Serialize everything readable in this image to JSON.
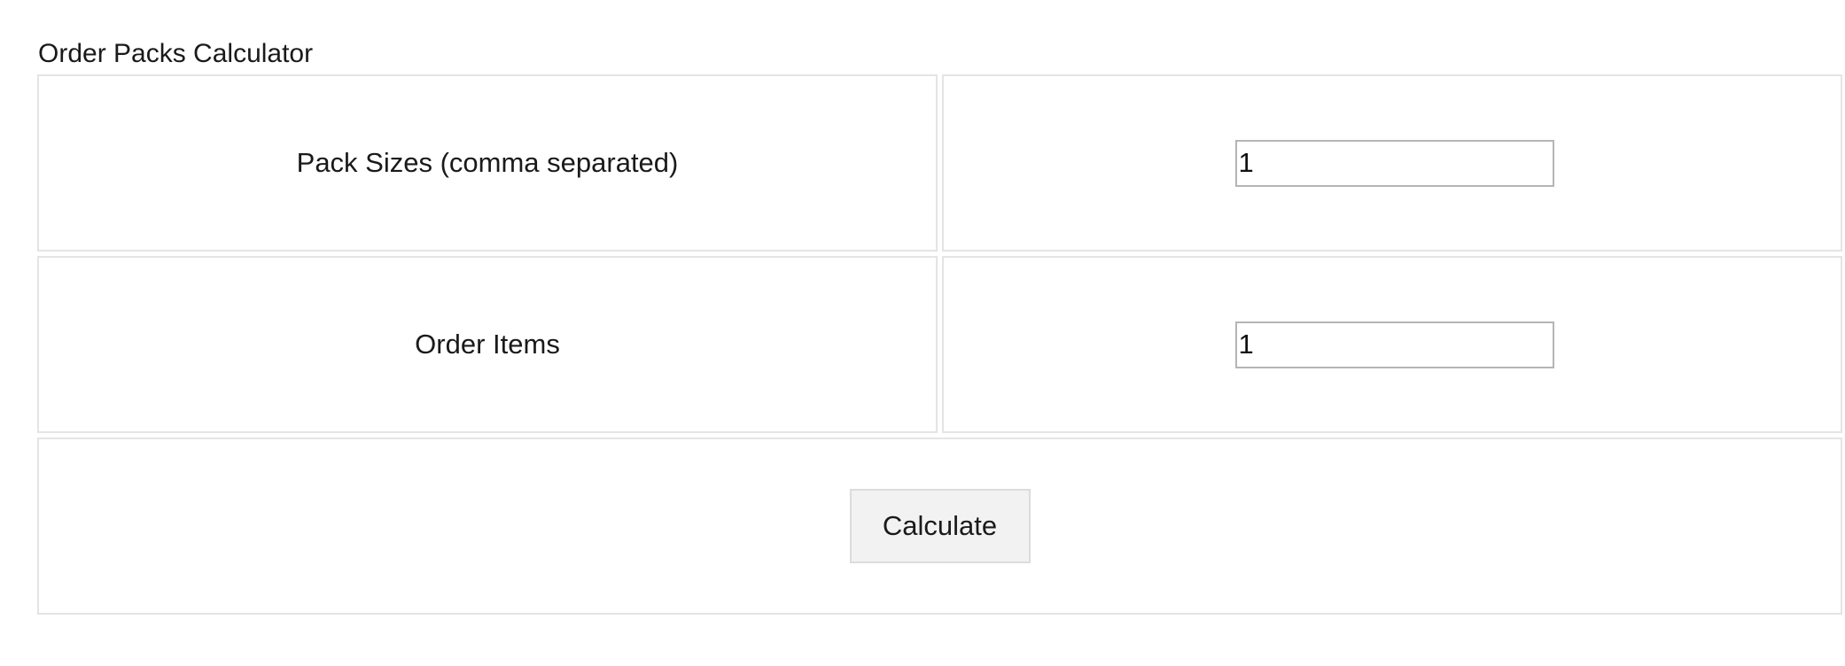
{
  "page": {
    "title": "Order Packs Calculator"
  },
  "form": {
    "pack_sizes": {
      "label": "Pack Sizes (comma separated)",
      "value": "1"
    },
    "order_items": {
      "label": "Order Items",
      "value": "1"
    },
    "calculate_label": "Calculate"
  }
}
